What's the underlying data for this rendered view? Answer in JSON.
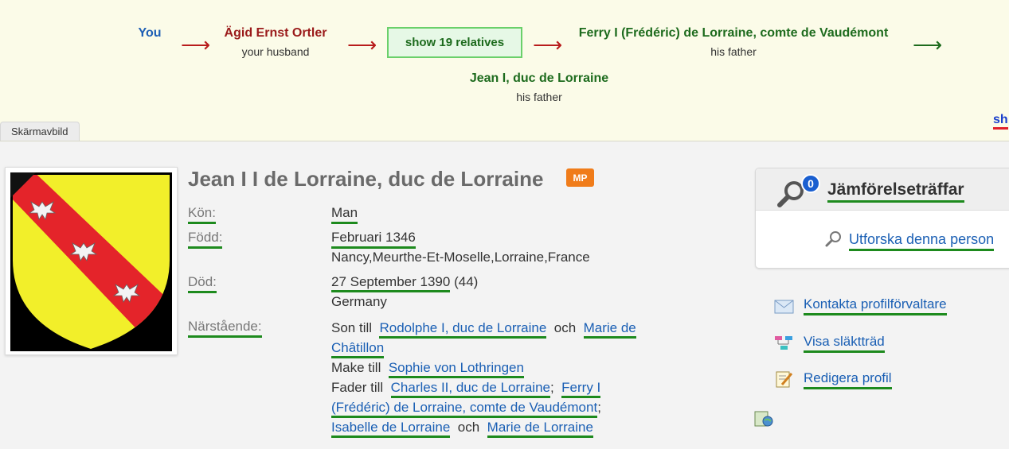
{
  "relationship_path": {
    "you": "You",
    "husband": {
      "name": "Ägid Ernst Ortler",
      "relation": "your husband"
    },
    "show_relatives": "show 19 relatives",
    "ferry": {
      "name": "Ferry I (Frédéric) de Lorraine, comte de Vaudémont",
      "relation": "his father"
    },
    "jean": {
      "name": "Jean I, duc de Lorraine",
      "relation": "his father"
    },
    "arrow_glyph": "⟶",
    "more_link": "sh",
    "screenshot_tab": "Skärmavbild"
  },
  "person": {
    "name": "Jean I I de Lorraine, duc de Lorraine",
    "badge": "MP",
    "fields": {
      "gender_label": "Kön:",
      "gender_value": "Man",
      "born_label": "Född:",
      "born_date": "Februari 1346",
      "born_place": "Nancy,Meurthe-Et-Moselle,Lorraine,France",
      "died_label": "Död:",
      "died_date": "27 September 1390",
      "died_age": "(44)",
      "died_place": "Germany",
      "relatives_label": "Närstående:"
    },
    "relatives": {
      "son_of_prefix": "Son till",
      "father": "Rodolphe I, duc de Lorraine",
      "och1": "och",
      "mother": "Marie de Châtillon",
      "spouse_prefix": "Make till",
      "spouse": "Sophie von Lothringen",
      "father_of_prefix": "Fader till",
      "child1": "Charles II, duc de Lorraine",
      "sep1": ";",
      "child2": "Ferry I (Frédéric) de Lorraine, comte de Vaudémont",
      "sep2": ";",
      "child3": "Isabelle de Lorraine",
      "och2": "och",
      "child4": "Marie de Lorraine"
    }
  },
  "sidebar": {
    "compare_title": "Jämförelseträffar",
    "compare_count": "0",
    "explore": "Utforska denna person",
    "actions": {
      "contact": "Kontakta profilförvaltare",
      "tree": "Visa släktträd",
      "edit": "Redigera profil"
    }
  },
  "colors": {
    "shield_yellow": "#f2ef2a",
    "shield_red": "#e4242a",
    "link_blue": "#1a5fb4",
    "underline_green": "#1d8a1d"
  }
}
